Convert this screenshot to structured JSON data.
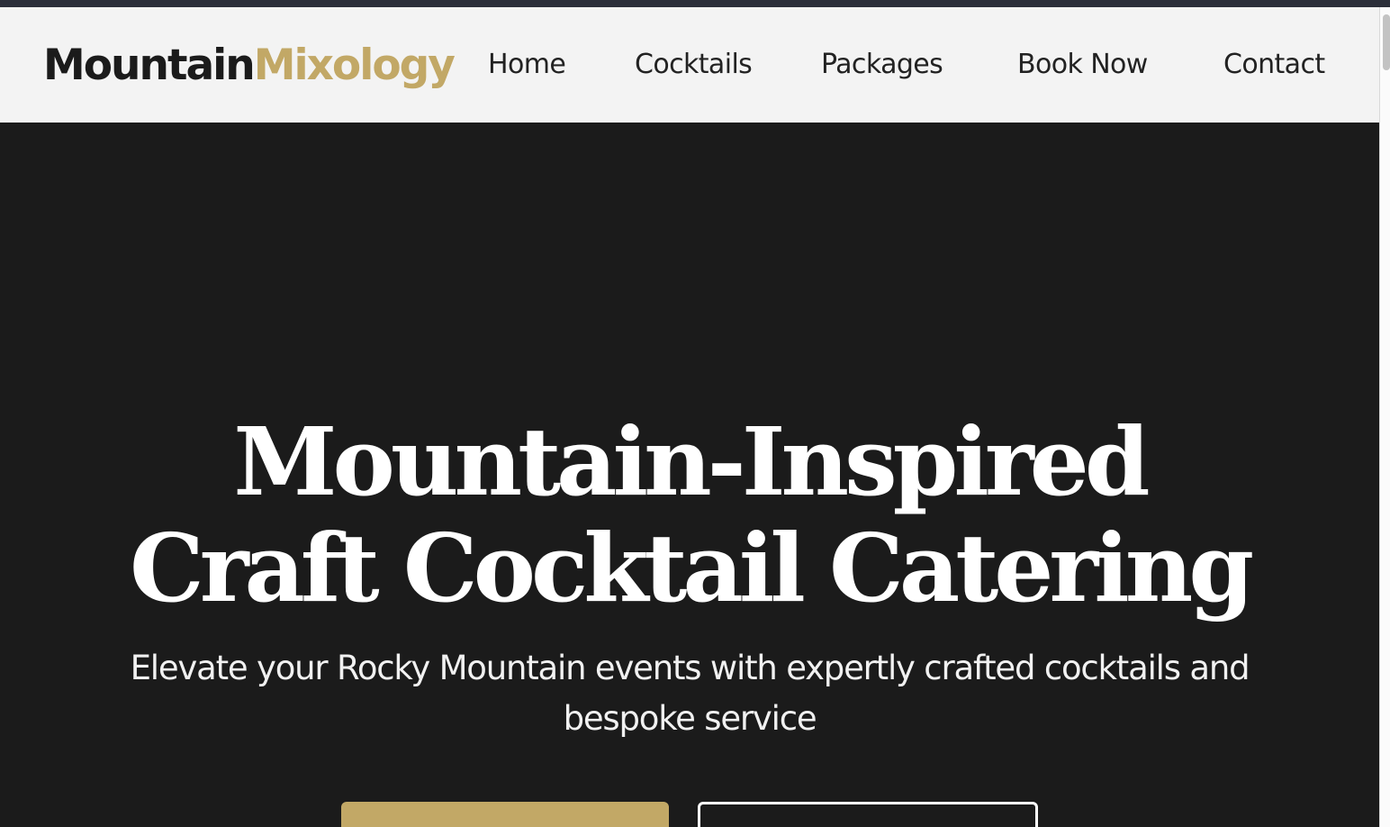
{
  "brand": {
    "name_part1": "Mountain",
    "name_part2": "Mixology",
    "accent_color": "#c2a866",
    "dark_color": "#1b1b1b"
  },
  "nav": {
    "items": [
      {
        "label": "Home"
      },
      {
        "label": "Cocktails"
      },
      {
        "label": "Packages"
      },
      {
        "label": "Book Now"
      },
      {
        "label": "Contact"
      }
    ]
  },
  "hero": {
    "title_line1": "Mountain-Inspired",
    "title_line2": "Craft Cocktail Catering",
    "subtitle": "Elevate your Rocky Mountain events with expertly crafted cocktails and bespoke service",
    "background_color": "#1b1b1b"
  }
}
